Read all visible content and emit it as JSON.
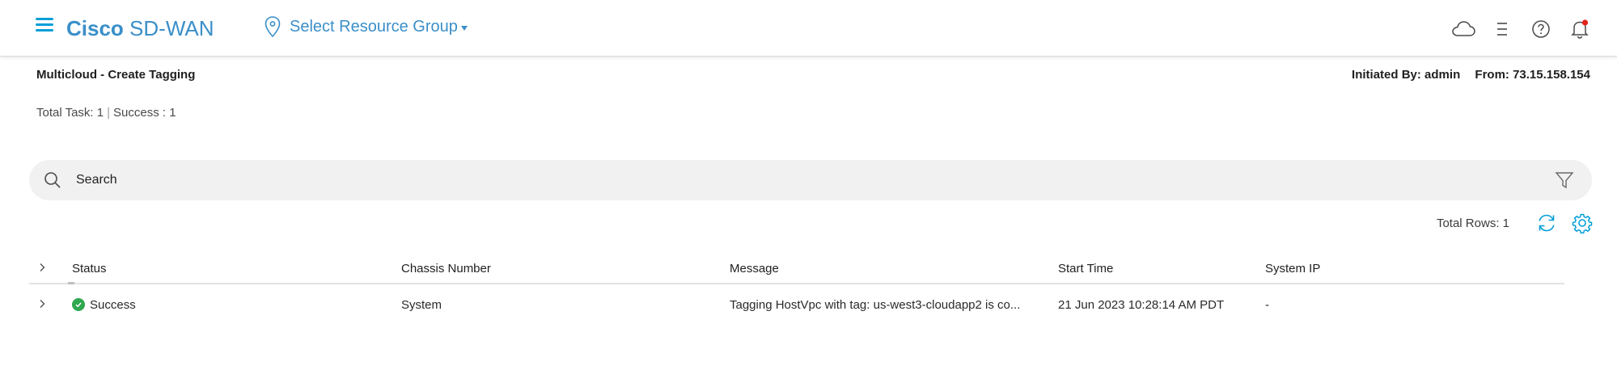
{
  "header": {
    "brand_bold": "Cisco",
    "brand_rest": "SD-WAN",
    "resource_group_label": "Select Resource Group",
    "icons": [
      "hamburger-menu-icon",
      "map-pin-icon",
      "cloud-icon",
      "list-icon",
      "help-icon",
      "bell-icon"
    ]
  },
  "task": {
    "title": "Multicloud - Create Tagging",
    "initiated_by": "Initiated By: admin",
    "from": "From: 73.15.158.154",
    "total_task": "Total Task: 1",
    "success_count": "Success : 1"
  },
  "search": {
    "placeholder": "Search"
  },
  "table": {
    "total_rows": "Total Rows: 1",
    "columns": [
      "Status",
      "Chassis Number",
      "Message",
      "Start Time",
      "System IP"
    ],
    "rows": [
      {
        "status": "Success",
        "chassis_number": "System",
        "message": "Tagging HostVpc with tag: us-west3-cloudapp2 is co...",
        "start_time": "21 Jun 2023 10:28:14 AM PDT",
        "system_ip": "-"
      }
    ]
  },
  "colors": {
    "brand": "#3a8fc9",
    "accent": "#049fd9",
    "success": "#2fa84f",
    "notification": "#e2231a",
    "search_bg": "#f1f1f2"
  }
}
